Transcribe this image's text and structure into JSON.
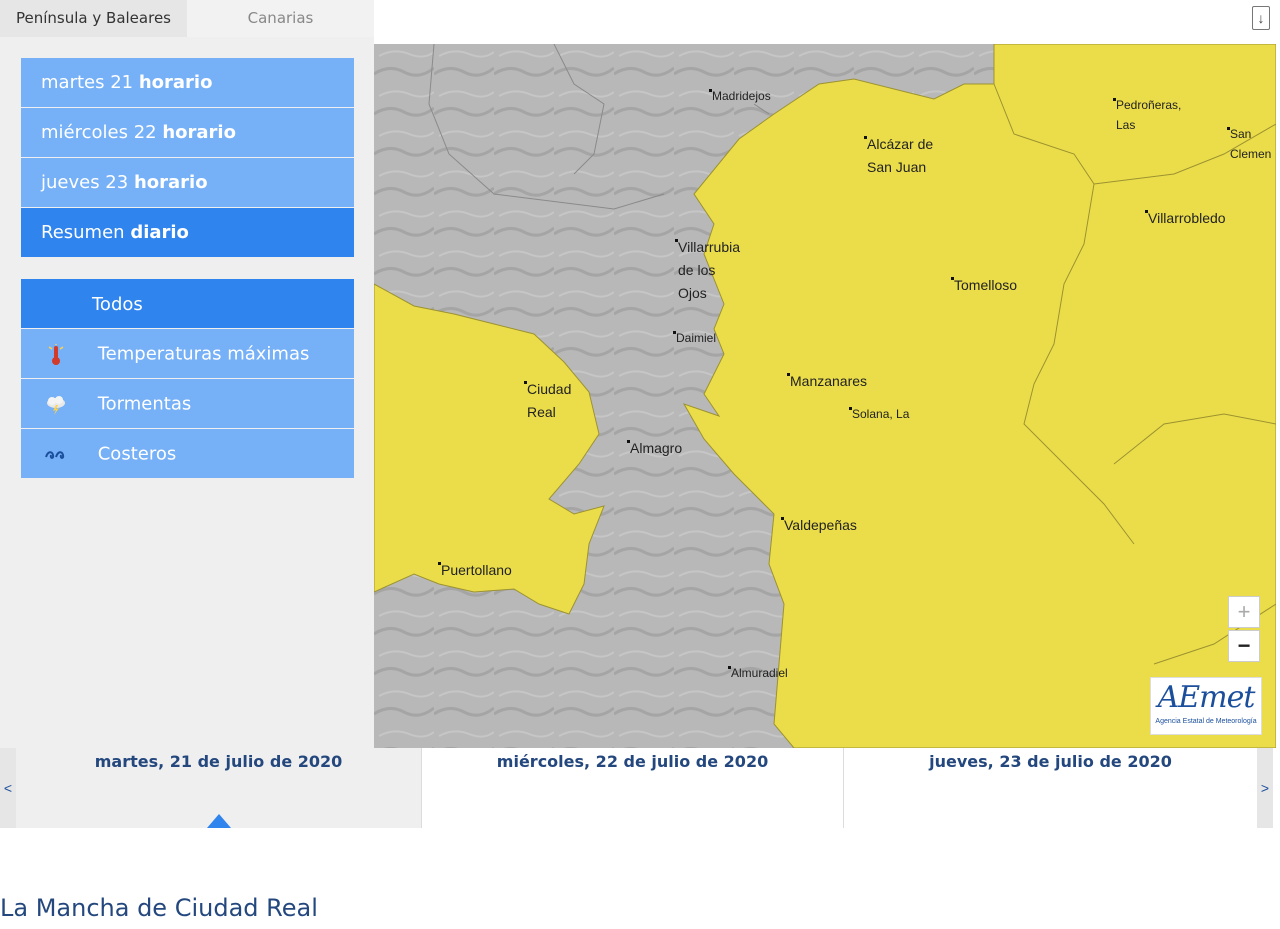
{
  "region_tabs": [
    {
      "label": "Península y Baleares",
      "active": true
    },
    {
      "label": "Canarias",
      "active": false
    }
  ],
  "days_menu": [
    {
      "day": "martes 21",
      "mode": "horario",
      "selected": false
    },
    {
      "day": "miércoles 22",
      "mode": "horario",
      "selected": false
    },
    {
      "day": "jueves 23",
      "mode": "horario",
      "selected": false
    },
    {
      "day": "Resumen",
      "mode": "diario",
      "selected": true
    }
  ],
  "types_menu": [
    {
      "label": "Todos",
      "icon": "none",
      "selected": true
    },
    {
      "label": "Temperaturas máximas",
      "icon": "thermometer-icon",
      "selected": false
    },
    {
      "label": "Tormentas",
      "icon": "storm-icon",
      "selected": false
    },
    {
      "label": "Costeros",
      "icon": "waves-icon",
      "selected": false
    }
  ],
  "map": {
    "towns": [
      {
        "name": "Madridejos",
        "size": "small"
      },
      {
        "name": "Alcázar de\nSan Juan",
        "size": "normal"
      },
      {
        "name": "Pedroñeras,\nLas",
        "size": "small"
      },
      {
        "name": "San\nClemen",
        "size": "small"
      },
      {
        "name": "Villarrobledo",
        "size": "normal"
      },
      {
        "name": "Villarrubia\nde los\nOjos",
        "size": "normal"
      },
      {
        "name": "Tomelloso",
        "size": "normal"
      },
      {
        "name": "Daimiel",
        "size": "small"
      },
      {
        "name": "Manzanares",
        "size": "normal"
      },
      {
        "name": "Solana, La",
        "size": "small"
      },
      {
        "name": "Ciudad\nReal",
        "size": "normal"
      },
      {
        "name": "Almagro",
        "size": "normal"
      },
      {
        "name": "Valdepeñas",
        "size": "normal"
      },
      {
        "name": "Puertollano",
        "size": "normal"
      },
      {
        "name": "Almuradiel",
        "size": "small"
      }
    ],
    "zoom_in_label": "+",
    "zoom_out_label": "−",
    "warning_color": "#ebdd4a",
    "no_warning_color": "#b3b3b3",
    "logo_name": "AEmet",
    "logo_subtitle": "Agencia Estatal de Meteorología"
  },
  "timeline": {
    "prev_label": "<",
    "next_label": ">",
    "days": [
      {
        "label": "martes, 21 de julio de 2020",
        "active": true
      },
      {
        "label": "miércoles, 22 de julio de 2020",
        "active": false
      },
      {
        "label": "jueves, 23 de julio de 2020",
        "active": false
      }
    ]
  },
  "zone_title": "La Mancha de Ciudad Real",
  "download_icon": "download-icon"
}
